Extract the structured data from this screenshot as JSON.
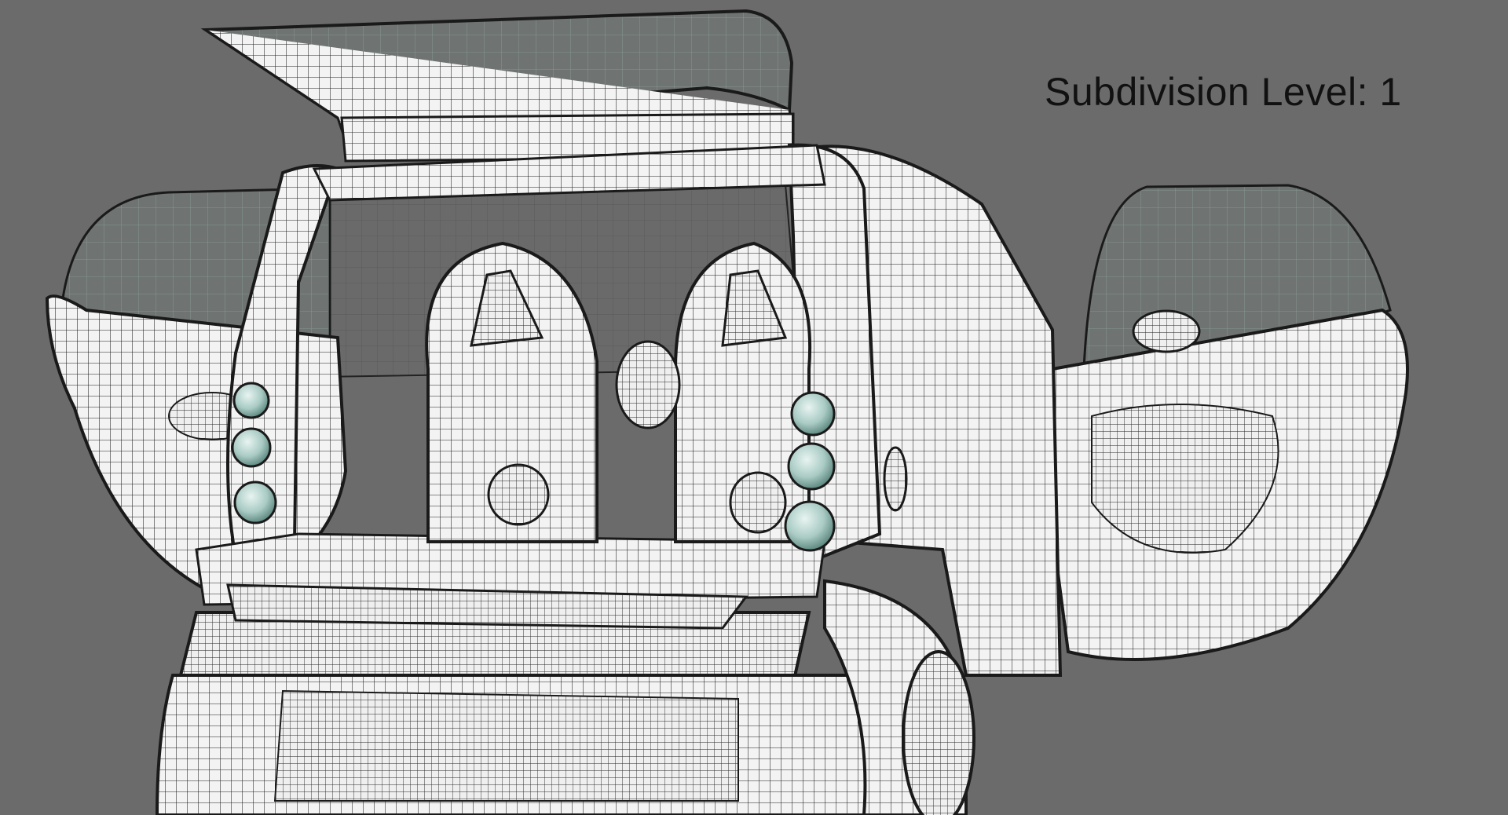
{
  "viewport": {
    "label_prefix": "Subdivision Level:",
    "level": "1",
    "label_full": "Subdivision Level: 1",
    "background_color": "#6b6b6b",
    "mesh_fill_color": "#f4f4f4",
    "wire_color": "#1a1a1a",
    "glass_color": "#8fb5ad",
    "lamp_color": "#a9cbc4"
  }
}
